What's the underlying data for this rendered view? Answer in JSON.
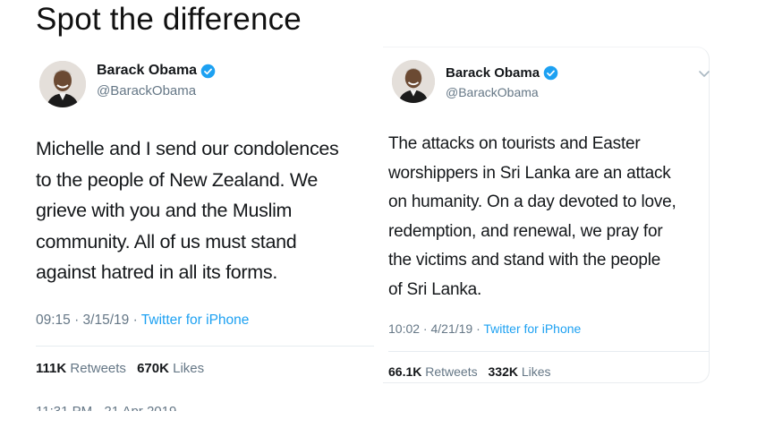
{
  "page": {
    "title": "Spot the difference"
  },
  "tweets": [
    {
      "name": "Barack Obama",
      "handle": "@BarackObama",
      "text": "Michelle and I send our condolences to the people of New Zealand. We grieve with you and the Muslim community. All of us must stand against hatred in all its forms.",
      "lines": [
        "Michelle and I send our condolences",
        "to the people of New Zealand. We",
        "grieve with you and the Muslim",
        "community. All of us must stand",
        "against hatred in all its forms."
      ],
      "time_date": "09:15 · 3/15/19 · ",
      "source": "Twitter for iPhone",
      "retweets": "111K",
      "retweets_label": "Retweets",
      "likes": "670K",
      "likes_label": "Likes",
      "cutoff_date": "11:31 PM - 21 Apr 2019"
    },
    {
      "name": "Barack Obama",
      "handle": "@BarackObama",
      "text": "The attacks on tourists and Easter worshippers in Sri Lanka are an attack on humanity. On a day devoted to love, redemption, and renewal, we pray for the victims and stand with the people of Sri Lanka.",
      "lines": [
        "The attacks on tourists and Easter",
        "worshippers in Sri Lanka are an attack",
        "on humanity. On a day devoted to love,",
        "redemption, and renewal, we pray for",
        "the victims and stand with the people",
        "of Sri Lanka."
      ],
      "time_date": "10:02 · 4/21/19 · ",
      "source": "Twitter for iPhone",
      "retweets": "66.1K",
      "retweets_label": "Retweets",
      "likes": "332K",
      "likes_label": "Likes"
    }
  ],
  "colors": {
    "verified": "#1da1f2",
    "link": "#1da1f2",
    "secondary_text": "#657786"
  },
  "icons": [
    "verified-badge-icon",
    "chevron-down-icon"
  ]
}
